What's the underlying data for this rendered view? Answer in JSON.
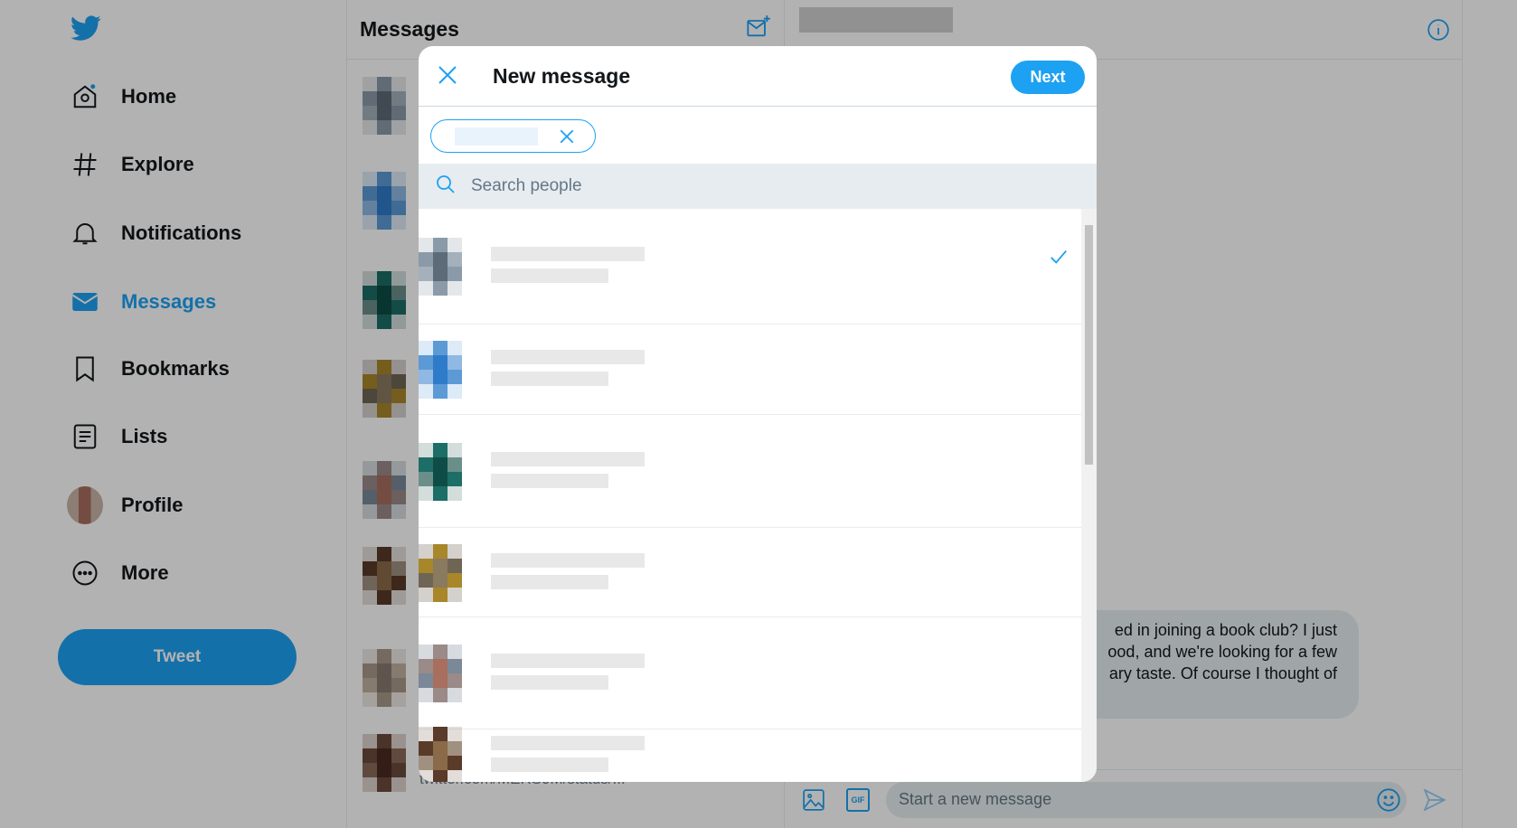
{
  "sidebar": {
    "items": [
      {
        "label": "Home",
        "icon": "home-icon"
      },
      {
        "label": "Explore",
        "icon": "hashtag-icon"
      },
      {
        "label": "Notifications",
        "icon": "bell-icon"
      },
      {
        "label": "Messages",
        "icon": "envelope-icon",
        "active": true
      },
      {
        "label": "Bookmarks",
        "icon": "bookmark-icon"
      },
      {
        "label": "Lists",
        "icon": "list-icon"
      },
      {
        "label": "Profile",
        "icon": "avatar"
      },
      {
        "label": "More",
        "icon": "more-icon"
      }
    ],
    "tweet_label": "Tweet"
  },
  "messages": {
    "title": "Messages",
    "link_preview": "twitter.com/MERS9M/status/..."
  },
  "conversation": {
    "bubble_lines": [
      "ed in joining a book club? I just",
      "ood, and we're looking for a few",
      "ary taste. Of course I thought of"
    ],
    "composer_placeholder": "Start a new message"
  },
  "modal": {
    "title": "New message",
    "next_label": "Next",
    "search_placeholder": "Search people"
  },
  "colors": {
    "accent": "#1da1f2",
    "search_bg": "#e6ecf0"
  }
}
